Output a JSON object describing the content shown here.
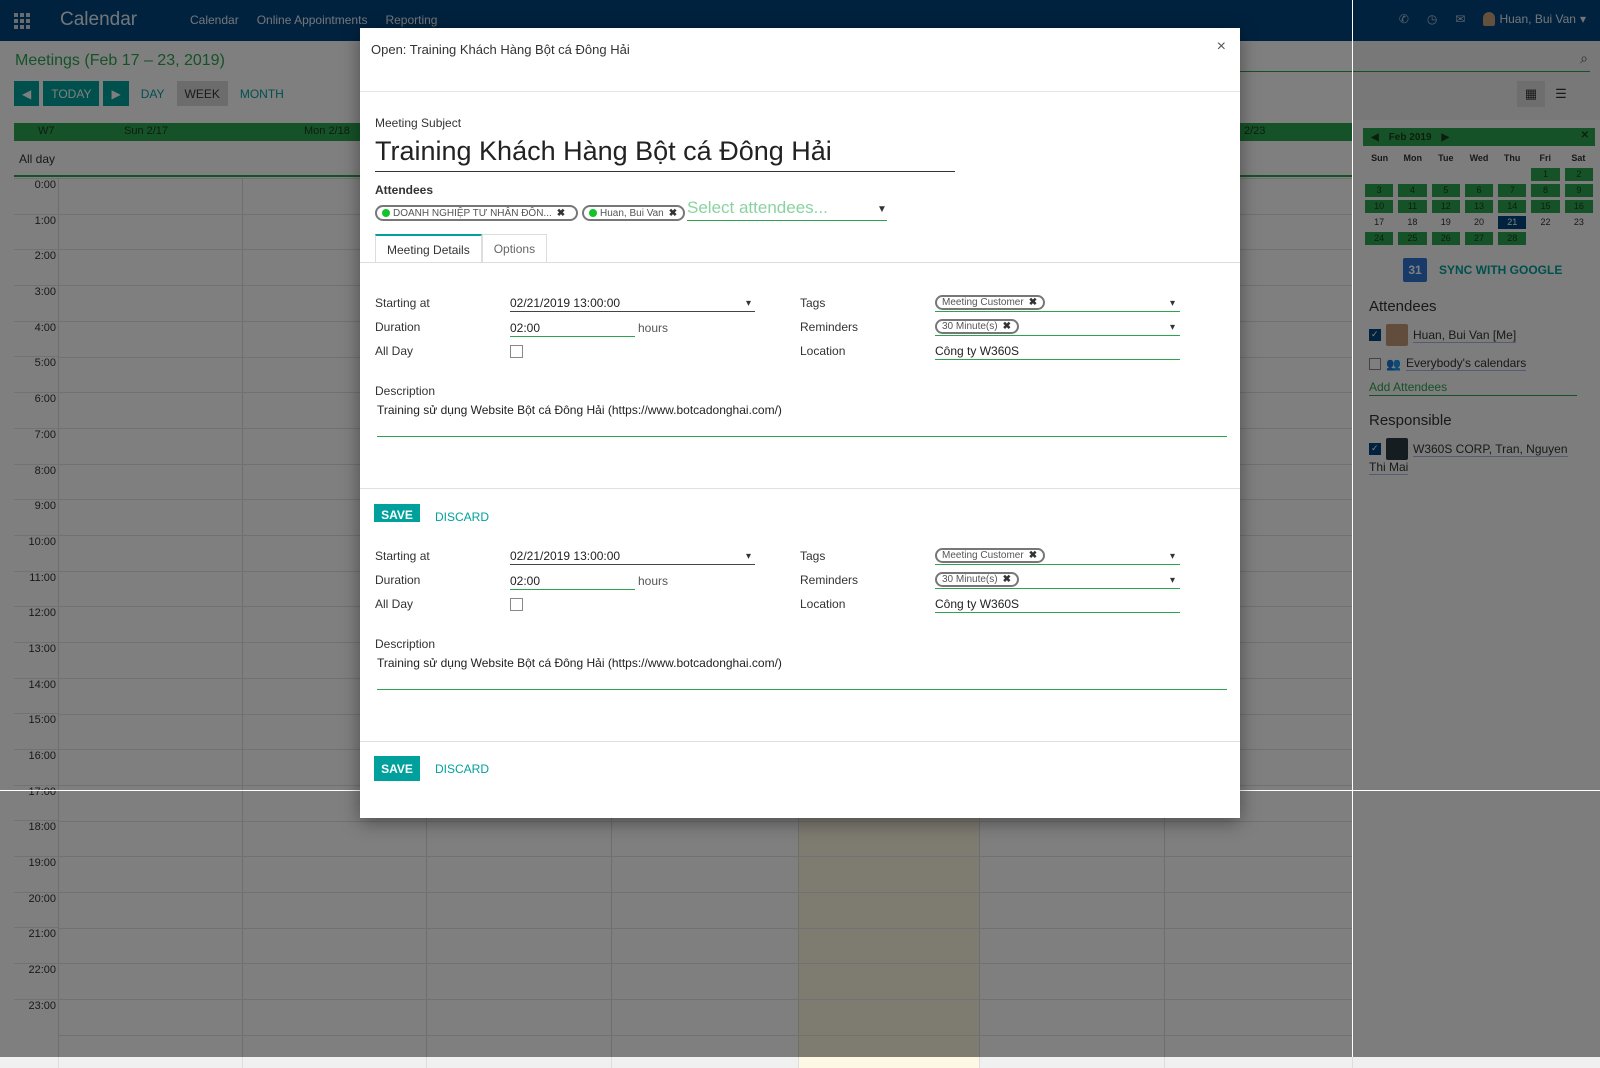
{
  "topbar": {
    "app_title": "Calendar",
    "menu": [
      "Calendar",
      "Online Appointments",
      "Reporting"
    ],
    "user_name": "Huan, Bui Van"
  },
  "calendar": {
    "breadcrumb": "Meetings (Feb 17 – 23, 2019)",
    "today_label": "TODAY",
    "views": [
      "DAY",
      "WEEK",
      "MONTH"
    ],
    "active_view": "WEEK",
    "week_label": "W7",
    "day_headers": [
      "Sun 2/17",
      "Mon 2/18",
      "2/23"
    ],
    "allday_label": "All day",
    "hours": [
      "0:00",
      "1:00",
      "2:00",
      "3:00",
      "4:00",
      "5:00",
      "6:00",
      "7:00",
      "8:00",
      "9:00",
      "10:00",
      "11:00",
      "12:00",
      "13:00",
      "14:00",
      "15:00",
      "16:00",
      "17:00",
      "18:00",
      "19:00",
      "20:00",
      "21:00",
      "22:00",
      "23:00"
    ]
  },
  "sidebar": {
    "mini_cal_title": "Feb 2019",
    "dow": [
      "Sun",
      "Mon",
      "Tue",
      "Wed",
      "Thu",
      "Fri",
      "Sat"
    ],
    "days": [
      "",
      "",
      "",
      "",
      "",
      "1",
      "2",
      "3",
      "4",
      "5",
      "6",
      "7",
      "8",
      "9",
      "10",
      "11",
      "12",
      "13",
      "14",
      "15",
      "16",
      "17",
      "18",
      "19",
      "20",
      "21",
      "22",
      "23",
      "24",
      "25",
      "26",
      "27",
      "28",
      "",
      ""
    ],
    "sync_label": "SYNC WITH GOOGLE",
    "gcal_number": "31",
    "attendees_title": "Attendees",
    "attendee_me": "Huan, Bui Van [Me]",
    "everybody": "Everybody's calendars",
    "add_attendees": "Add Attendees",
    "responsible_title": "Responsible",
    "responsible_line1": "W360S CORP, Tran, Nguyen",
    "responsible_line2": "Thi Mai"
  },
  "modal": {
    "title": "Open: Training Khách Hàng Bột cá Đông Hải",
    "close_glyph": "×",
    "subject_label": "Meeting Subject",
    "subject": "Training Khách Hàng Bột cá Đông Hải",
    "attendees_label": "Attendees",
    "attendee_tags": [
      "DOANH NGHIỆP TƯ NHÂN ĐÔN...",
      "Huan, Bui Van"
    ],
    "attendees_placeholder": "Select attendees...",
    "tabs": [
      "Meeting Details",
      "Options"
    ],
    "form": {
      "starting_label": "Starting at",
      "starting_value": "02/21/2019 13:00:00",
      "duration_label": "Duration",
      "duration_value": "02:00",
      "duration_unit": "hours",
      "allday_label": "All Day",
      "tags_label": "Tags",
      "tags_value": "Meeting Customer",
      "reminders_label": "Reminders",
      "reminders_value": "30 Minute(s)",
      "location_label": "Location",
      "location_value": "Công ty W360S",
      "description_label": "Description",
      "description_value": "Training sử dụng Website Bột cá Đông Hải (https://www.botcadonghai.com/)"
    },
    "save_label": "SAVE",
    "discard_label": "DISCARD"
  }
}
